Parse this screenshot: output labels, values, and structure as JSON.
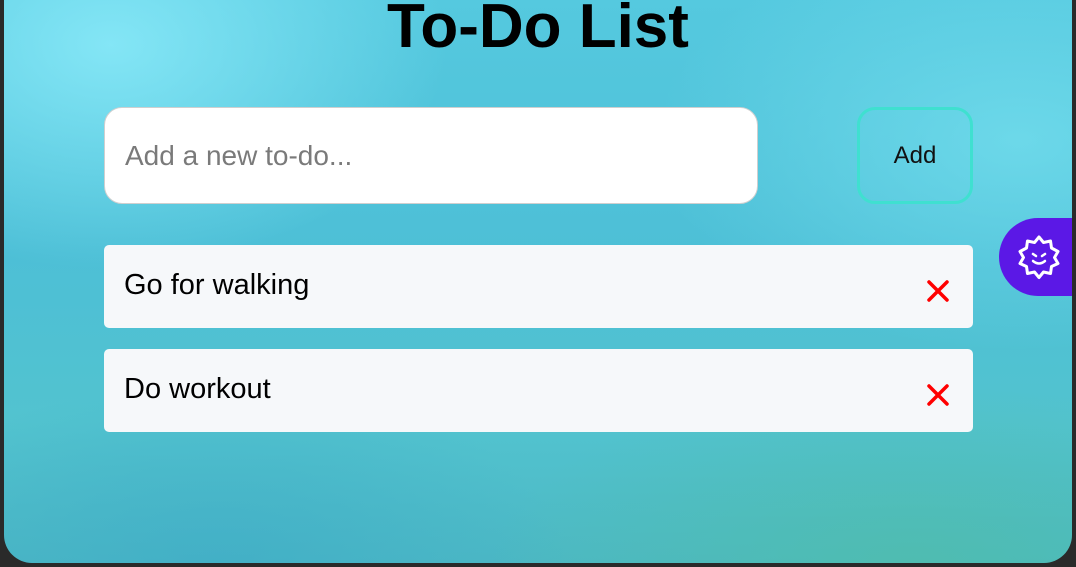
{
  "app": {
    "title": "To-Do List"
  },
  "input": {
    "placeholder": "Add a new to-do...",
    "value": ""
  },
  "add_button": {
    "label": "Add"
  },
  "todos": [
    {
      "text": "Go for walking",
      "delete_icon": "close-icon"
    },
    {
      "text": "Do workout",
      "delete_icon": "close-icon"
    }
  ],
  "assistant": {
    "icon": "badge-smile-icon"
  },
  "colors": {
    "delete": "#ff0000",
    "add_border": "#3fe0d0",
    "assistant_bg": "#5b18e6",
    "item_bg": "#f6f8fa"
  }
}
